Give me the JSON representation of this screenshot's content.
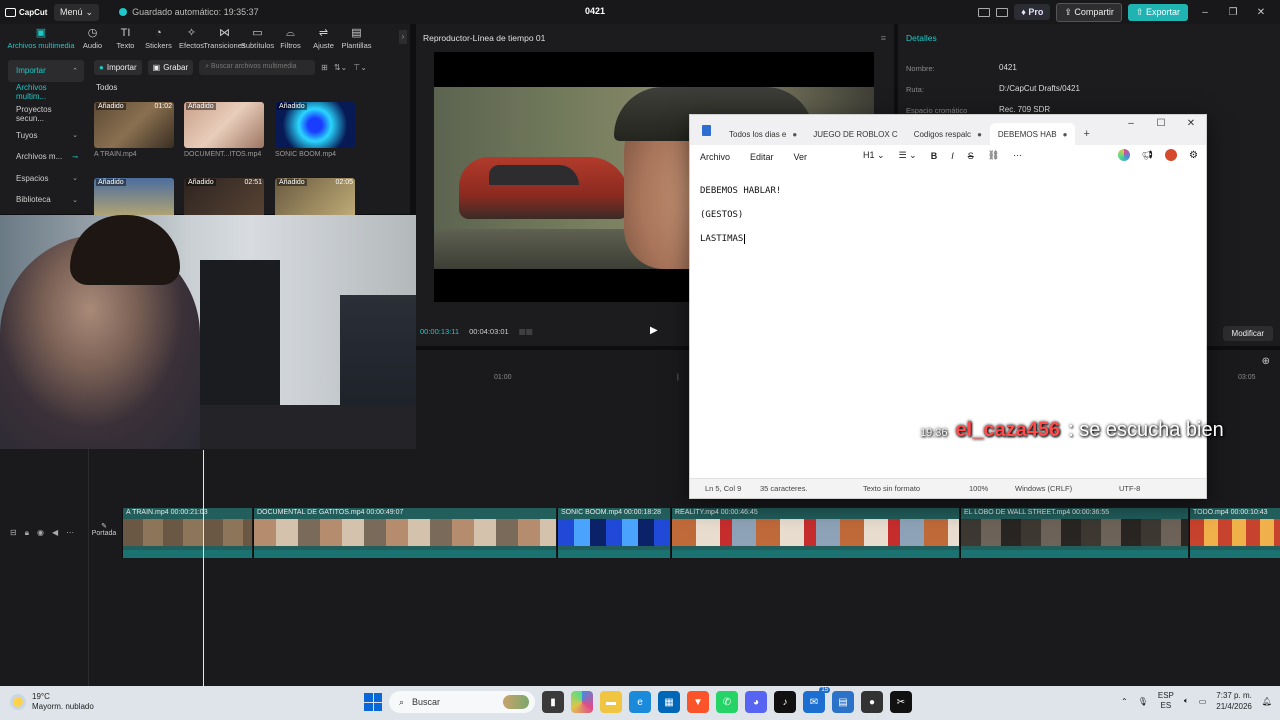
{
  "capcut": {
    "app_name": "CapCut",
    "menu_label": "Menú",
    "autosave_text": "Guardado automático: 19:35:37",
    "project_title": "0421",
    "pro_label": "Pro",
    "share_label": "Compartir",
    "export_label": "Exportar",
    "accent_color": "#1fc8c6"
  },
  "toolbar": {
    "items": [
      {
        "label": "Archivos multimedia",
        "icon": "media-icon"
      },
      {
        "label": "Audio",
        "icon": "audio-icon"
      },
      {
        "label": "Texto",
        "icon": "text-icon"
      },
      {
        "label": "Stickers",
        "icon": "sticker-icon"
      },
      {
        "label": "Efectos",
        "icon": "effects-icon"
      },
      {
        "label": "Transiciones",
        "icon": "transitions-icon"
      },
      {
        "label": "Subtítulos",
        "icon": "subtitles-icon"
      },
      {
        "label": "Filtros",
        "icon": "filters-icon"
      },
      {
        "label": "Ajuste",
        "icon": "adjust-icon"
      },
      {
        "label": "Plantillas",
        "icon": "templates-icon"
      }
    ]
  },
  "sidebar": {
    "items": [
      {
        "label": "Importar"
      },
      {
        "label": "Archivos multim..."
      },
      {
        "label": "Proyectos secun..."
      },
      {
        "label": "Tuyos"
      },
      {
        "label": "Archivos m..."
      },
      {
        "label": "Espacios"
      },
      {
        "label": "Biblioteca"
      }
    ]
  },
  "media": {
    "import_label": "Importar",
    "record_label": "Grabar",
    "search_placeholder": "Buscar archivos multimedia",
    "filter_label": "Todos",
    "added_tag": "Añadido",
    "thumbnails": [
      {
        "name": "A TRAIN.mp4",
        "duration": "01:02"
      },
      {
        "name": "DOCUMENT...ITOS.mp4",
        "duration": ""
      },
      {
        "name": "SONIC BOOM.mp4",
        "duration": ""
      },
      {
        "name": "",
        "duration": ""
      },
      {
        "name": "",
        "duration": "02:51"
      },
      {
        "name": "",
        "duration": "02:05"
      }
    ]
  },
  "player": {
    "title": "Reproductor-Línea de tiempo 01",
    "current_time": "00:00:13:11",
    "total_time": "00:04:03:01"
  },
  "details": {
    "title": "Detalles",
    "rows": [
      {
        "label": "Nombre:",
        "value": "0421"
      },
      {
        "label": "Ruta:",
        "value": "D:/CapCut Drafts/0421"
      },
      {
        "label": "Espacio cromático",
        "value": "Rec. 709 SDR"
      }
    ],
    "modify_label": "Modificar"
  },
  "timeline": {
    "ruler_labels": [
      "01:00",
      "|",
      "03:05"
    ],
    "cover_label": "Portada",
    "clips": [
      {
        "label": "A TRAIN.mp4   00:00:21:03"
      },
      {
        "label": "DOCUMENTAL DE GATITOS.mp4   00:00:49:07"
      },
      {
        "label": "SONIC BOOM.mp4   00:00:18:28"
      },
      {
        "label": "REALITY.mp4   00:00:46:45"
      },
      {
        "label": "EL LOBO DE WALL STREET.mp4   00:00:36:55"
      },
      {
        "label": "TODO.mp4   00:00:10:43"
      }
    ]
  },
  "notepad": {
    "tabs": [
      {
        "label": "Todos los dias e",
        "active": false
      },
      {
        "label": "JUEGO DE ROBLOX C",
        "active": false
      },
      {
        "label": "Codigos respalc",
        "active": false
      },
      {
        "label": "DEBEMOS HAB",
        "active": true
      }
    ],
    "menu": [
      "Archivo",
      "Editar",
      "Ver"
    ],
    "heading_label": "H1",
    "lines": [
      "DEBEMOS HABLAR!",
      "(GESTOS)",
      "LASTIMAS"
    ],
    "status": {
      "position": "Ln 5, Col 9",
      "chars": "35 caracteres.",
      "format": "Texto sin formato",
      "zoom": "100%",
      "eol": "Windows (CRLF)",
      "encoding": "UTF-8"
    }
  },
  "chat": {
    "time": "19:36",
    "user": "el_caza456",
    "message": ": se escucha bien"
  },
  "taskbar": {
    "temperature": "19°C",
    "weather": "Mayorm. nublado",
    "search_label": "Buscar",
    "lang_top": "ESP",
    "lang_bottom": "ES",
    "time": "7:37 p. m.",
    "date": "21/4/2026",
    "badge_count": "15"
  }
}
